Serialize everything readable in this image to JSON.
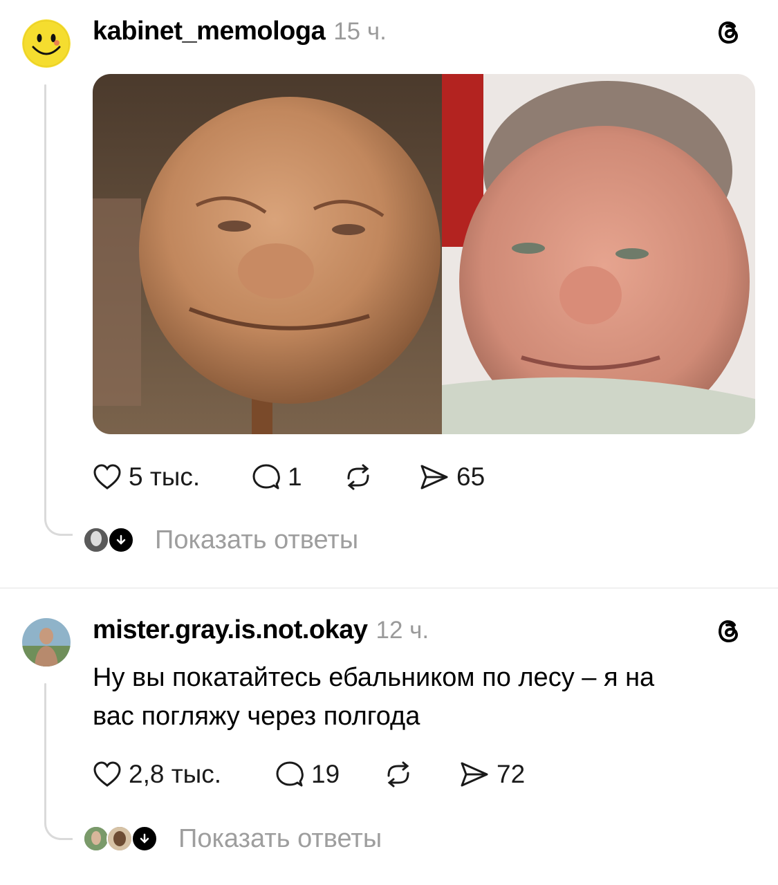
{
  "post1": {
    "username": "kabinet_memologa",
    "time": "15 ч.",
    "likes": "5 тыс.",
    "comments": "1",
    "shares": "65",
    "show_replies": "Показать ответы",
    "image_alt": "meme photo: clay ball face vs man's face"
  },
  "post2": {
    "username": "mister.gray.is.not.okay",
    "time": "12 ч.",
    "text_line1": "Ну вы покатайтесь ебальником по лесу – я на",
    "text_line2": "вас погляжу через полгода",
    "likes": "2,8 тыс.",
    "comments": "19",
    "shares": "72",
    "show_replies": "Показать ответы"
  },
  "icons": {
    "like": "heart-icon",
    "comment": "comment-icon",
    "repost": "repost-icon",
    "share": "send-icon",
    "app": "threads-logo-icon",
    "replies": "arrow-down-icon"
  },
  "colors": {
    "muted": "#9e9e9e",
    "line": "#dadada",
    "divider": "#e3e3e3",
    "text": "#000000"
  }
}
